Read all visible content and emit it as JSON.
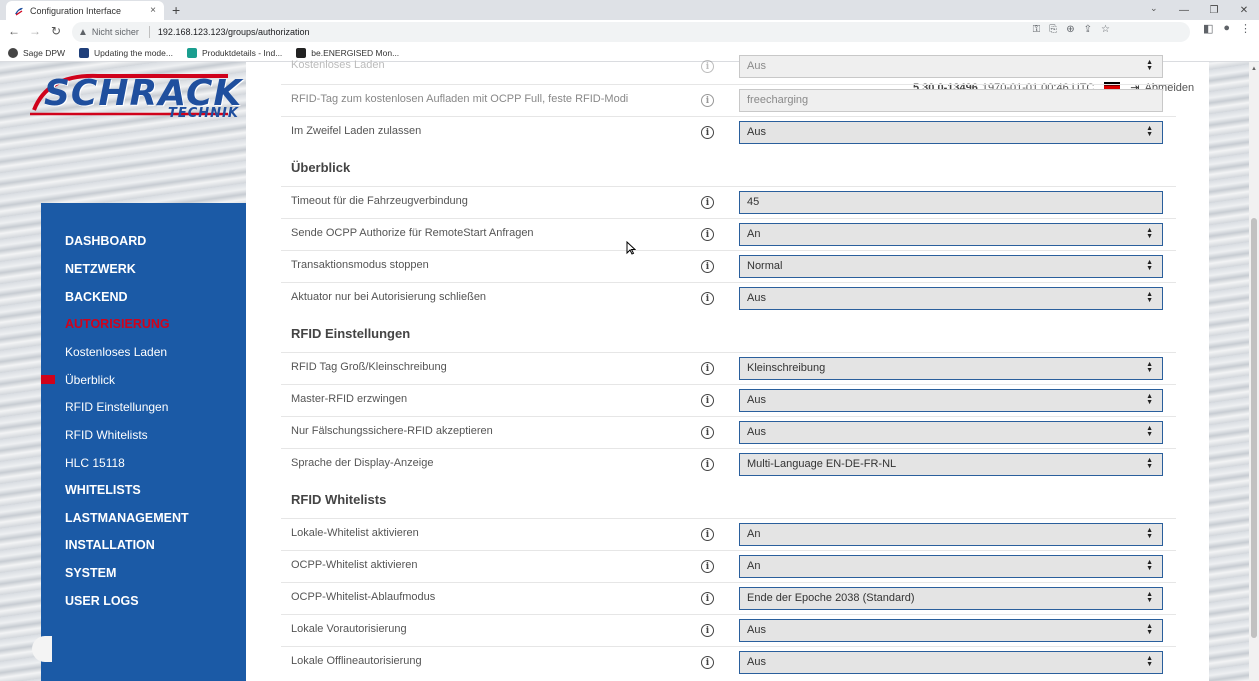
{
  "browser": {
    "tab_title": "Configuration Interface",
    "tab_close": "×",
    "new_tab": "+",
    "security_label": "Nicht sicher",
    "url": "192.168.123.123/groups/authorization",
    "bookmarks": [
      {
        "label": "Sage DPW",
        "color": "#444444"
      },
      {
        "label": "Updating the mode...",
        "color": "#1f3f7a"
      },
      {
        "label": "Produktdetails - Ind...",
        "color": "#1a9e8f"
      },
      {
        "label": "be.ENERGISED Mon...",
        "color": "#222222"
      }
    ]
  },
  "header": {
    "version": "5.30.0-13496",
    "datetime": "1970-01-01 00:46 UTC",
    "logout_label": "Abmelden"
  },
  "logo": {
    "main": "SCHRACK",
    "sub": "TECHNIK",
    "brand_color": "#1f4f9e",
    "accent_color": "#d0021b"
  },
  "sidebar": {
    "items": [
      {
        "label": "DASHBOARD",
        "type": "main"
      },
      {
        "label": "NETZWERK",
        "type": "main"
      },
      {
        "label": "BACKEND",
        "type": "main"
      },
      {
        "label": "AUTORISIERUNG",
        "type": "main",
        "active": true
      },
      {
        "label": "Kostenloses Laden",
        "type": "sub"
      },
      {
        "label": "Überblick",
        "type": "sub",
        "marker": true
      },
      {
        "label": "RFID Einstellungen",
        "type": "sub"
      },
      {
        "label": "RFID Whitelists",
        "type": "sub"
      },
      {
        "label": "HLC 15118",
        "type": "sub"
      },
      {
        "label": "WHITELISTS",
        "type": "main"
      },
      {
        "label": "LASTMANAGEMENT",
        "type": "main"
      },
      {
        "label": "INSTALLATION",
        "type": "main"
      },
      {
        "label": "SYSTEM",
        "type": "main"
      },
      {
        "label": "USER LOGS",
        "type": "main"
      }
    ]
  },
  "sections": {
    "ueberblick": "Überblick",
    "rfid_einstellungen": "RFID Einstellungen",
    "rfid_whitelists": "RFID Whitelists"
  },
  "rows": {
    "kostenloses_laden": {
      "label": "Kostenloses Laden",
      "value": "Aus"
    },
    "rfid_tag_free": {
      "label": "RFID-Tag zum kostenlosen Aufladen mit OCPP Full, feste RFID-Modi",
      "value": "freecharging"
    },
    "zweifel": {
      "label": "Im Zweifel Laden zulassen",
      "value": "Aus"
    },
    "timeout": {
      "label": "Timeout für die Fahrzeugverbindung",
      "value": "45"
    },
    "ocpp_authorize": {
      "label": "Sende OCPP Authorize für RemoteStart Anfragen",
      "value": "An"
    },
    "transaktionsmodus": {
      "label": "Transaktionsmodus stoppen",
      "value": "Normal"
    },
    "aktuator": {
      "label": "Aktuator nur bei Autorisierung schließen",
      "value": "Aus"
    },
    "rfid_case": {
      "label": "RFID Tag Groß/Kleinschreibung",
      "value": "Kleinschreibung"
    },
    "master_rfid": {
      "label": "Master-RFID erzwingen",
      "value": "Aus"
    },
    "faelschung": {
      "label": "Nur Fälschungssichere-RFID akzeptieren",
      "value": "Aus"
    },
    "sprache": {
      "label": "Sprache der Display-Anzeige",
      "value": "Multi-Language EN-DE-FR-NL"
    },
    "lokale_whitelist": {
      "label": "Lokale-Whitelist aktivieren",
      "value": "An"
    },
    "ocpp_whitelist": {
      "label": "OCPP-Whitelist aktivieren",
      "value": "An"
    },
    "ocpp_ablauf": {
      "label": "OCPP-Whitelist-Ablaufmodus",
      "value": "Ende der Epoche 2038 (Standard)"
    },
    "vorautorisierung": {
      "label": "Lokale Vorautorisierung",
      "value": "Aus"
    },
    "offline": {
      "label": "Lokale Offlineautorisierung",
      "value": "Aus"
    }
  }
}
